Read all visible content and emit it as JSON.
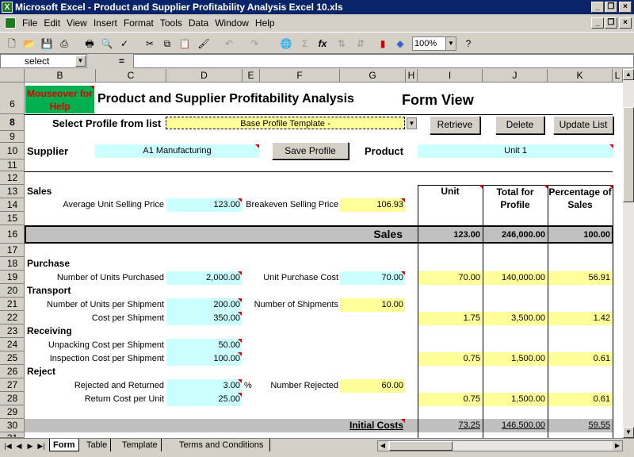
{
  "window": {
    "title": "Microsoft Excel - Product and Supplier Profitability Analysis Excel 10.xls"
  },
  "menu": [
    "File",
    "Edit",
    "View",
    "Insert",
    "Format",
    "Tools",
    "Data",
    "Window",
    "Help"
  ],
  "toolbar": {
    "zoom": "100%"
  },
  "formula_bar": {
    "name_box": "select",
    "equals": "="
  },
  "columns": [
    "B",
    "C",
    "D",
    "E",
    "F",
    "G",
    "H",
    "I",
    "J",
    "K",
    "L"
  ],
  "rows": [
    "6",
    "8",
    "9",
    "10",
    "11",
    "12",
    "13",
    "14",
    "15",
    "16",
    "17",
    "18",
    "19",
    "20",
    "21",
    "22",
    "23",
    "24",
    "25",
    "26",
    "27",
    "28",
    "29",
    "30",
    "31"
  ],
  "header": {
    "help_button": "Mouseover for Help",
    "title": "Product and Supplier Profitability Analysis",
    "view": "Form View"
  },
  "profile": {
    "label": "Select Profile from list",
    "selected": "Base Profile Template -",
    "retrieve": "Retrieve",
    "delete": "Delete",
    "update": "Update List"
  },
  "supplier": {
    "label": "Supplier",
    "value": "A1 Manufacturing",
    "save": "Save Profile"
  },
  "product": {
    "label": "Product",
    "value": "Unit 1"
  },
  "col_heads": {
    "unit": "Unit",
    "total": "Total for Profile",
    "pct": "Percentage of Sales"
  },
  "sales": {
    "section": "Sales",
    "avg_price_label": "Average Unit Selling Price",
    "avg_price": "123.00",
    "breakeven_label": "Breakeven Selling Price",
    "breakeven": "106.93",
    "row_label": "Sales",
    "unit": "123.00",
    "total": "246,000.00",
    "pct": "100.00"
  },
  "purchase": {
    "section": "Purchase",
    "units_label": "Number of Units Purchased",
    "units": "2,000.00",
    "cost_label": "Unit Purchase Cost",
    "cost": "70.00",
    "unit": "70.00",
    "total": "140,000.00",
    "pct": "56.91"
  },
  "transport": {
    "section": "Transport",
    "per_ship_label": "Number of Units per Shipment",
    "per_ship": "200.00",
    "num_ship_label": "Number of Shipments",
    "num_ship": "10.00",
    "cost_label": "Cost per Shipment",
    "cost": "350.00",
    "unit": "1.75",
    "total": "3,500.00",
    "pct": "1.42"
  },
  "receiving": {
    "section": "Receiving",
    "unpack_label": "Unpacking Cost per Shipment",
    "unpack": "50.00",
    "inspect_label": "Inspection Cost per Shipment",
    "inspect": "100.00",
    "unit": "0.75",
    "total": "1,500.00",
    "pct": "0.61"
  },
  "reject": {
    "section": "Reject",
    "rate_label": "Rejected and Returned",
    "rate": "3.00",
    "rate_unit": "%",
    "num_label": "Number Rejected",
    "num": "60.00",
    "return_label": "Return Cost per Unit",
    "return": "25.00",
    "unit": "0.75",
    "total": "1,500.00",
    "pct": "0.61"
  },
  "initial": {
    "label": "Initial Costs",
    "unit": "73.25",
    "total": "146,500.00",
    "pct": "59.55"
  },
  "tabs": [
    "Form",
    "Table",
    "Template",
    "Terms and Conditions"
  ]
}
